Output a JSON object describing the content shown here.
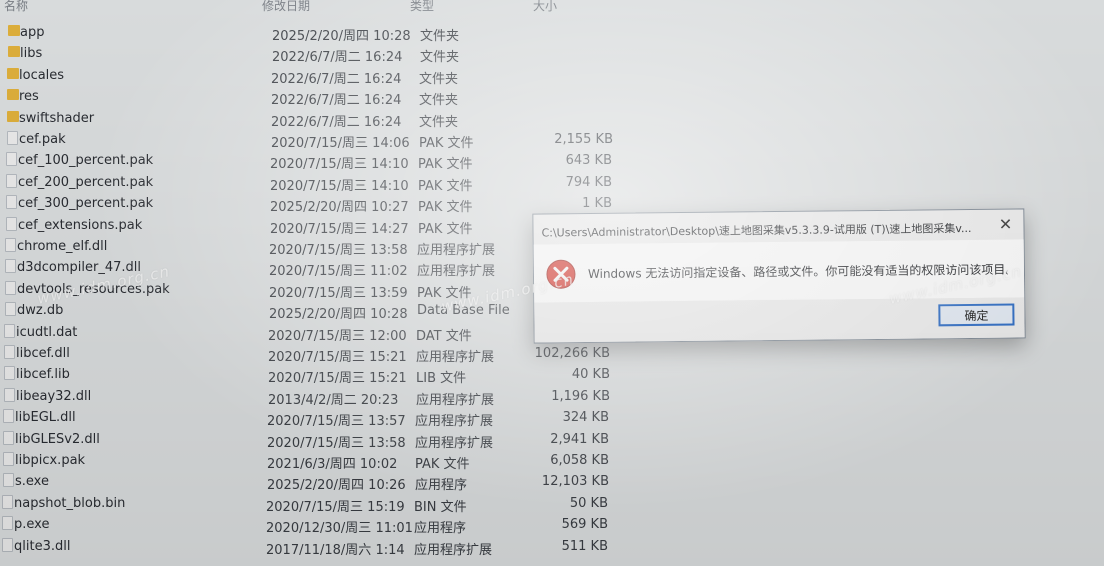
{
  "header": {
    "name_col": "名称",
    "date_col": "修改日期",
    "type_col": "类型",
    "size_col": "大小"
  },
  "files": [
    {
      "name": "app",
      "date": "2025/2/20/周四 10:28",
      "type": "文件夹",
      "size": "",
      "folder": true
    },
    {
      "name": "libs",
      "date": "2022/6/7/周二 16:24",
      "type": "文件夹",
      "size": "",
      "folder": true
    },
    {
      "name": "locales",
      "date": "2022/6/7/周二 16:24",
      "type": "文件夹",
      "size": "",
      "folder": true
    },
    {
      "name": "res",
      "date": "2022/6/7/周二 16:24",
      "type": "文件夹",
      "size": "",
      "folder": true
    },
    {
      "name": "swiftshader",
      "date": "2022/6/7/周二 16:24",
      "type": "文件夹",
      "size": "",
      "folder": true
    },
    {
      "name": "cef.pak",
      "date": "2020/7/15/周三 14:06",
      "type": "PAK 文件",
      "size": "2,155 KB",
      "folder": false
    },
    {
      "name": "cef_100_percent.pak",
      "date": "2020/7/15/周三 14:10",
      "type": "PAK 文件",
      "size": "643 KB",
      "folder": false
    },
    {
      "name": "cef_200_percent.pak",
      "date": "2020/7/15/周三 14:10",
      "type": "PAK 文件",
      "size": "794 KB",
      "folder": false
    },
    {
      "name": "cef_300_percent.pak",
      "date": "2025/2/20/周四 10:27",
      "type": "PAK 文件",
      "size": "1 KB",
      "folder": false
    },
    {
      "name": "cef_extensions.pak",
      "date": "2020/7/15/周三 14:27",
      "type": "PAK 文件",
      "size": "",
      "folder": false
    },
    {
      "name": "chrome_elf.dll",
      "date": "2020/7/15/周三 13:58",
      "type": "应用程序扩展",
      "size": "",
      "folder": false
    },
    {
      "name": "d3dcompiler_47.dll",
      "date": "2020/7/15/周三 11:02",
      "type": "应用程序扩展",
      "size": "",
      "folder": false
    },
    {
      "name": "devtools_resources.pak",
      "date": "2020/7/15/周三 13:59",
      "type": "PAK 文件",
      "size": "",
      "folder": false
    },
    {
      "name": "dwz.db",
      "date": "2025/2/20/周四 10:28",
      "type": "Data Base File",
      "size": "",
      "folder": false
    },
    {
      "name": "icudtl.dat",
      "date": "2020/7/15/周三 12:00",
      "type": "DAT 文件",
      "size": "",
      "folder": false
    },
    {
      "name": "libcef.dll",
      "date": "2020/7/15/周三 15:21",
      "type": "应用程序扩展",
      "size": "102,266 KB",
      "folder": false
    },
    {
      "name": "libcef.lib",
      "date": "2020/7/15/周三 15:21",
      "type": "LIB 文件",
      "size": "40 KB",
      "folder": false
    },
    {
      "name": "libeay32.dll",
      "date": "2013/4/2/周二 20:23",
      "type": "应用程序扩展",
      "size": "1,196 KB",
      "folder": false
    },
    {
      "name": "libEGL.dll",
      "date": "2020/7/15/周三 13:57",
      "type": "应用程序扩展",
      "size": "324 KB",
      "folder": false
    },
    {
      "name": "libGLESv2.dll",
      "date": "2020/7/15/周三 13:58",
      "type": "应用程序扩展",
      "size": "2,941 KB",
      "folder": false
    },
    {
      "name": "libpicx.pak",
      "date": "2021/6/3/周四 10:02",
      "type": "PAK 文件",
      "size": "6,058 KB",
      "folder": false
    },
    {
      "name": "s.exe",
      "date": "2025/2/20/周四 10:26",
      "type": "应用程序",
      "size": "12,103 KB",
      "folder": false
    },
    {
      "name": "napshot_blob.bin",
      "date": "2020/7/15/周三 15:19",
      "type": "BIN 文件",
      "size": "50 KB",
      "folder": false
    },
    {
      "name": "p.exe",
      "date": "2020/12/30/周三 11:01",
      "type": "应用程序",
      "size": "569 KB",
      "folder": false
    },
    {
      "name": "qlite3.dll",
      "date": "2017/11/18/周六 1:14",
      "type": "应用程序扩展",
      "size": "511 KB",
      "folder": false
    }
  ],
  "dialog": {
    "title": "C:\\Users\\Administrator\\Desktop\\速上地图采集v5.3.3.9-试用版 (T)\\速上地图采集v...",
    "close_glyph": "✕",
    "message": "Windows 无法访问指定设备、路径或文件。你可能没有适当的权限访问该项目。",
    "ok_label": "确定"
  },
  "watermark": {
    "text1": "www.idm.org.cn",
    "text2": "www.idm.org.cn",
    "text3": "www.idm.org.cn"
  },
  "colors": {
    "folder": "#e3b33d",
    "error_red": "#d9342b",
    "button_border": "#2a6bc7"
  }
}
